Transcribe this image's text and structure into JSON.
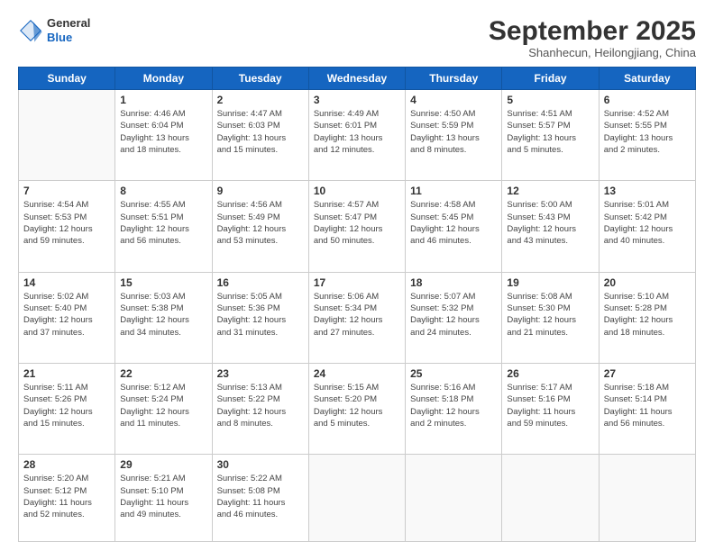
{
  "header": {
    "logo": {
      "general": "General",
      "blue": "Blue"
    },
    "month": "September 2025",
    "location": "Shanhecun, Heilongjiang, China"
  },
  "weekdays": [
    "Sunday",
    "Monday",
    "Tuesday",
    "Wednesday",
    "Thursday",
    "Friday",
    "Saturday"
  ],
  "weeks": [
    [
      {
        "day": "",
        "info": ""
      },
      {
        "day": "1",
        "info": "Sunrise: 4:46 AM\nSunset: 6:04 PM\nDaylight: 13 hours\nand 18 minutes."
      },
      {
        "day": "2",
        "info": "Sunrise: 4:47 AM\nSunset: 6:03 PM\nDaylight: 13 hours\nand 15 minutes."
      },
      {
        "day": "3",
        "info": "Sunrise: 4:49 AM\nSunset: 6:01 PM\nDaylight: 13 hours\nand 12 minutes."
      },
      {
        "day": "4",
        "info": "Sunrise: 4:50 AM\nSunset: 5:59 PM\nDaylight: 13 hours\nand 8 minutes."
      },
      {
        "day": "5",
        "info": "Sunrise: 4:51 AM\nSunset: 5:57 PM\nDaylight: 13 hours\nand 5 minutes."
      },
      {
        "day": "6",
        "info": "Sunrise: 4:52 AM\nSunset: 5:55 PM\nDaylight: 13 hours\nand 2 minutes."
      }
    ],
    [
      {
        "day": "7",
        "info": "Sunrise: 4:54 AM\nSunset: 5:53 PM\nDaylight: 12 hours\nand 59 minutes."
      },
      {
        "day": "8",
        "info": "Sunrise: 4:55 AM\nSunset: 5:51 PM\nDaylight: 12 hours\nand 56 minutes."
      },
      {
        "day": "9",
        "info": "Sunrise: 4:56 AM\nSunset: 5:49 PM\nDaylight: 12 hours\nand 53 minutes."
      },
      {
        "day": "10",
        "info": "Sunrise: 4:57 AM\nSunset: 5:47 PM\nDaylight: 12 hours\nand 50 minutes."
      },
      {
        "day": "11",
        "info": "Sunrise: 4:58 AM\nSunset: 5:45 PM\nDaylight: 12 hours\nand 46 minutes."
      },
      {
        "day": "12",
        "info": "Sunrise: 5:00 AM\nSunset: 5:43 PM\nDaylight: 12 hours\nand 43 minutes."
      },
      {
        "day": "13",
        "info": "Sunrise: 5:01 AM\nSunset: 5:42 PM\nDaylight: 12 hours\nand 40 minutes."
      }
    ],
    [
      {
        "day": "14",
        "info": "Sunrise: 5:02 AM\nSunset: 5:40 PM\nDaylight: 12 hours\nand 37 minutes."
      },
      {
        "day": "15",
        "info": "Sunrise: 5:03 AM\nSunset: 5:38 PM\nDaylight: 12 hours\nand 34 minutes."
      },
      {
        "day": "16",
        "info": "Sunrise: 5:05 AM\nSunset: 5:36 PM\nDaylight: 12 hours\nand 31 minutes."
      },
      {
        "day": "17",
        "info": "Sunrise: 5:06 AM\nSunset: 5:34 PM\nDaylight: 12 hours\nand 27 minutes."
      },
      {
        "day": "18",
        "info": "Sunrise: 5:07 AM\nSunset: 5:32 PM\nDaylight: 12 hours\nand 24 minutes."
      },
      {
        "day": "19",
        "info": "Sunrise: 5:08 AM\nSunset: 5:30 PM\nDaylight: 12 hours\nand 21 minutes."
      },
      {
        "day": "20",
        "info": "Sunrise: 5:10 AM\nSunset: 5:28 PM\nDaylight: 12 hours\nand 18 minutes."
      }
    ],
    [
      {
        "day": "21",
        "info": "Sunrise: 5:11 AM\nSunset: 5:26 PM\nDaylight: 12 hours\nand 15 minutes."
      },
      {
        "day": "22",
        "info": "Sunrise: 5:12 AM\nSunset: 5:24 PM\nDaylight: 12 hours\nand 11 minutes."
      },
      {
        "day": "23",
        "info": "Sunrise: 5:13 AM\nSunset: 5:22 PM\nDaylight: 12 hours\nand 8 minutes."
      },
      {
        "day": "24",
        "info": "Sunrise: 5:15 AM\nSunset: 5:20 PM\nDaylight: 12 hours\nand 5 minutes."
      },
      {
        "day": "25",
        "info": "Sunrise: 5:16 AM\nSunset: 5:18 PM\nDaylight: 12 hours\nand 2 minutes."
      },
      {
        "day": "26",
        "info": "Sunrise: 5:17 AM\nSunset: 5:16 PM\nDaylight: 11 hours\nand 59 minutes."
      },
      {
        "day": "27",
        "info": "Sunrise: 5:18 AM\nSunset: 5:14 PM\nDaylight: 11 hours\nand 56 minutes."
      }
    ],
    [
      {
        "day": "28",
        "info": "Sunrise: 5:20 AM\nSunset: 5:12 PM\nDaylight: 11 hours\nand 52 minutes."
      },
      {
        "day": "29",
        "info": "Sunrise: 5:21 AM\nSunset: 5:10 PM\nDaylight: 11 hours\nand 49 minutes."
      },
      {
        "day": "30",
        "info": "Sunrise: 5:22 AM\nSunset: 5:08 PM\nDaylight: 11 hours\nand 46 minutes."
      },
      {
        "day": "",
        "info": ""
      },
      {
        "day": "",
        "info": ""
      },
      {
        "day": "",
        "info": ""
      },
      {
        "day": "",
        "info": ""
      }
    ]
  ]
}
